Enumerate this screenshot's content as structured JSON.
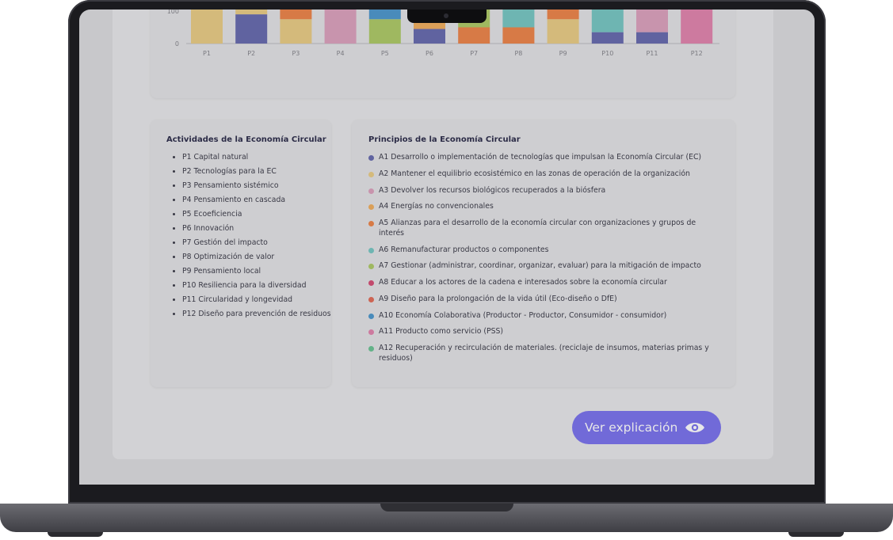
{
  "chart": {
    "categories": [
      "P1",
      "P2",
      "P3",
      "P4",
      "P5",
      "P6",
      "P7",
      "P8",
      "P9",
      "P10",
      "P11",
      "P12"
    ],
    "y_ticks": [
      "100",
      "0"
    ]
  },
  "activities": {
    "title": "Actividades de la Economía Circular",
    "items": [
      "P1 Capital natural",
      "P2 Tecnologías para la EC",
      "P3 Pensamiento sistémico",
      "P4 Pensamiento en cascada",
      "P5 Ecoeficiencia",
      "P6 Innovación",
      "P7 Gestión del impacto",
      "P8 Optimización de valor",
      "P9 Pensamiento local",
      "P10 Resiliencia para la diversidad",
      "P11 Circularidad y longevidad",
      "P12 Diseño para prevención de residuos"
    ]
  },
  "principles": {
    "title": "Principios de la Economía Circular",
    "items": [
      {
        "label": "A1 Desarrollo o implementación de tecnologías que impulsan la Economía Circular (EC)",
        "color": "#5b5fa8"
      },
      {
        "label": "A2 Mantener el equilibrio ecosistémico en las zonas de operación de la organización",
        "color": "#e8c87a"
      },
      {
        "label": "A3 Devolver los recursos biológicos recuperados a la biósfera",
        "color": "#d99ab8"
      },
      {
        "label": "A4 Energías no convencionales",
        "color": "#f0a850"
      },
      {
        "label": "A5 Alianzas para el desarrollo de la economía circular con organizaciones y grupos de interés",
        "color": "#ec7a3a"
      },
      {
        "label": "A6 Remanufacturar productos o componentes",
        "color": "#6cc2bd"
      },
      {
        "label": "A7 Gestionar (administrar, coordinar, organizar, evaluar) para la mitigación de impacto",
        "color": "#a8c65a"
      },
      {
        "label": "A8 Educar a los actores de la cadena e interesados sobre la economía circular",
        "color": "#d2406a"
      },
      {
        "label": "A9 Diseño para la prolongación de la vida útil (Eco-diseño o DfE)",
        "color": "#e0604a"
      },
      {
        "label": "A10 Economía Colaborativa (Productor - Productor, Consumidor - consumidor)",
        "color": "#3f8fc9"
      },
      {
        "label": "A11 Producto como servicio (PSS)",
        "color": "#e07aa6"
      },
      {
        "label": "A12 Recuperación y recirculación de materiales. (reciclaje de insumos, materias primas y residuos)",
        "color": "#5fbf8a"
      }
    ]
  },
  "button": {
    "label": "Ver explicación",
    "icon": "eye-icon"
  },
  "colors": {
    "accent": "#6f67ec"
  }
}
